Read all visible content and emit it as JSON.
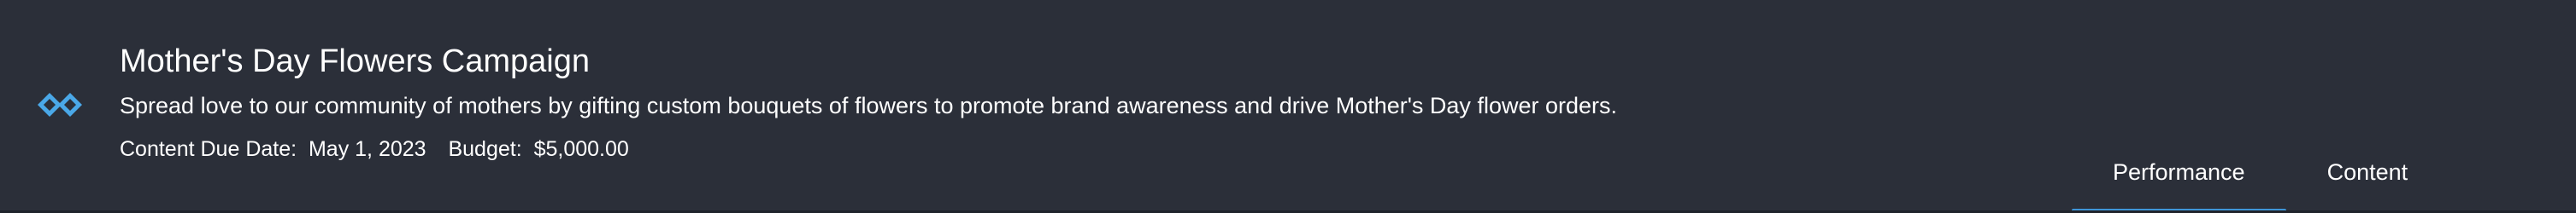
{
  "campaign": {
    "title": "Mother's Day Flowers Campaign",
    "description": "Spread love to our community of mothers by gifting custom bouquets of flowers to promote brand awareness and drive Mother's Day flower orders.",
    "content_due_label": "Content Due Date:",
    "content_due_value": "May 1, 2023",
    "budget_label": "Budget:",
    "budget_value": "$5,000.00"
  },
  "logo": {
    "icon": "diamond-chevrons-icon",
    "color": "#4aa8e8"
  },
  "tabs": [
    {
      "label": "Performance",
      "active": true
    },
    {
      "label": "Content",
      "active": false
    }
  ],
  "colors": {
    "background": "#2b2f39",
    "accent": "#3e95d8",
    "text": "#ffffff"
  }
}
